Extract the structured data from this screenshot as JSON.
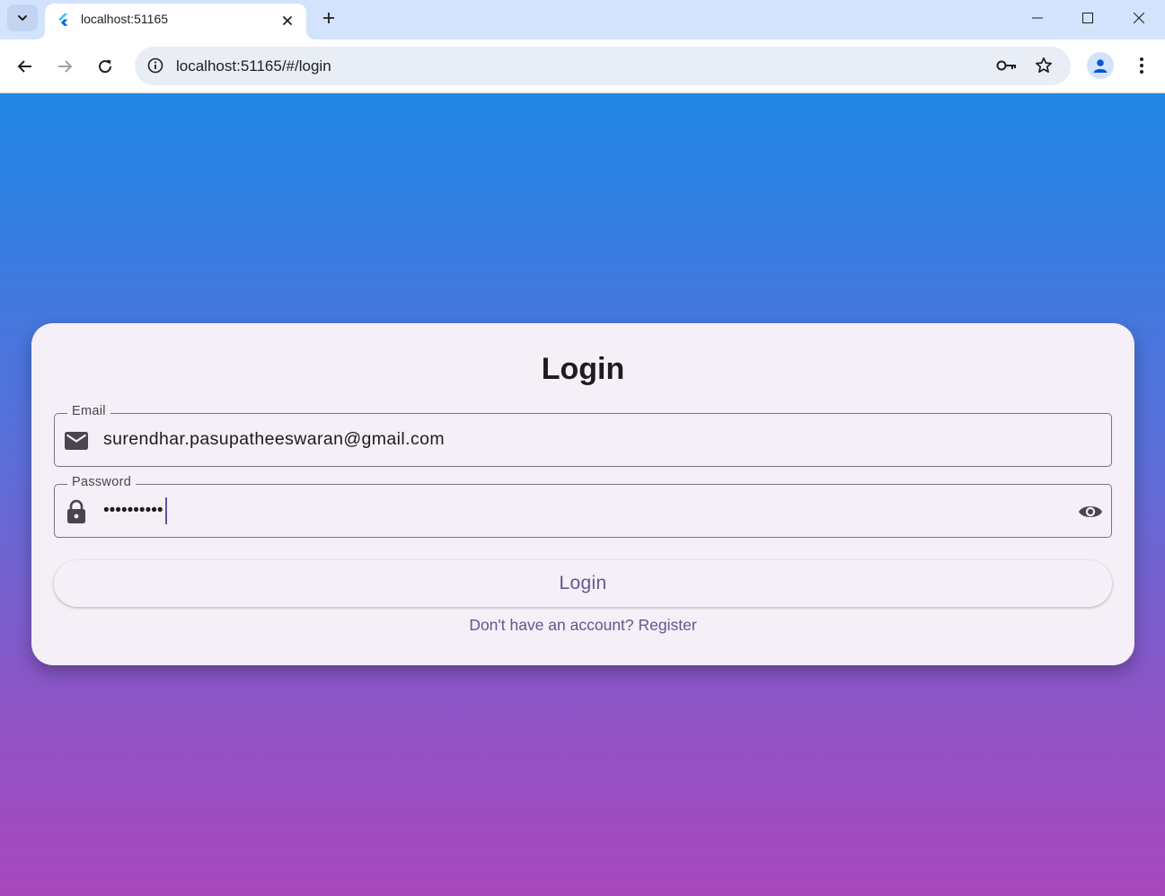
{
  "browser": {
    "tab_title": "localhost:51165",
    "url": "localhost:51165/#/login"
  },
  "login": {
    "title": "Login",
    "email_label": "Email",
    "email_value": "surendhar.pasupatheeswaran@gmail.com",
    "password_label": "Password",
    "password_masked": "••••••••••",
    "submit_label": "Login",
    "register_link": "Don't have an account? Register"
  },
  "colors": {
    "gradient_top": "#1f87e6",
    "gradient_bottom": "#a847bd",
    "card_background": "#f5eff7",
    "accent": "#65558f"
  }
}
